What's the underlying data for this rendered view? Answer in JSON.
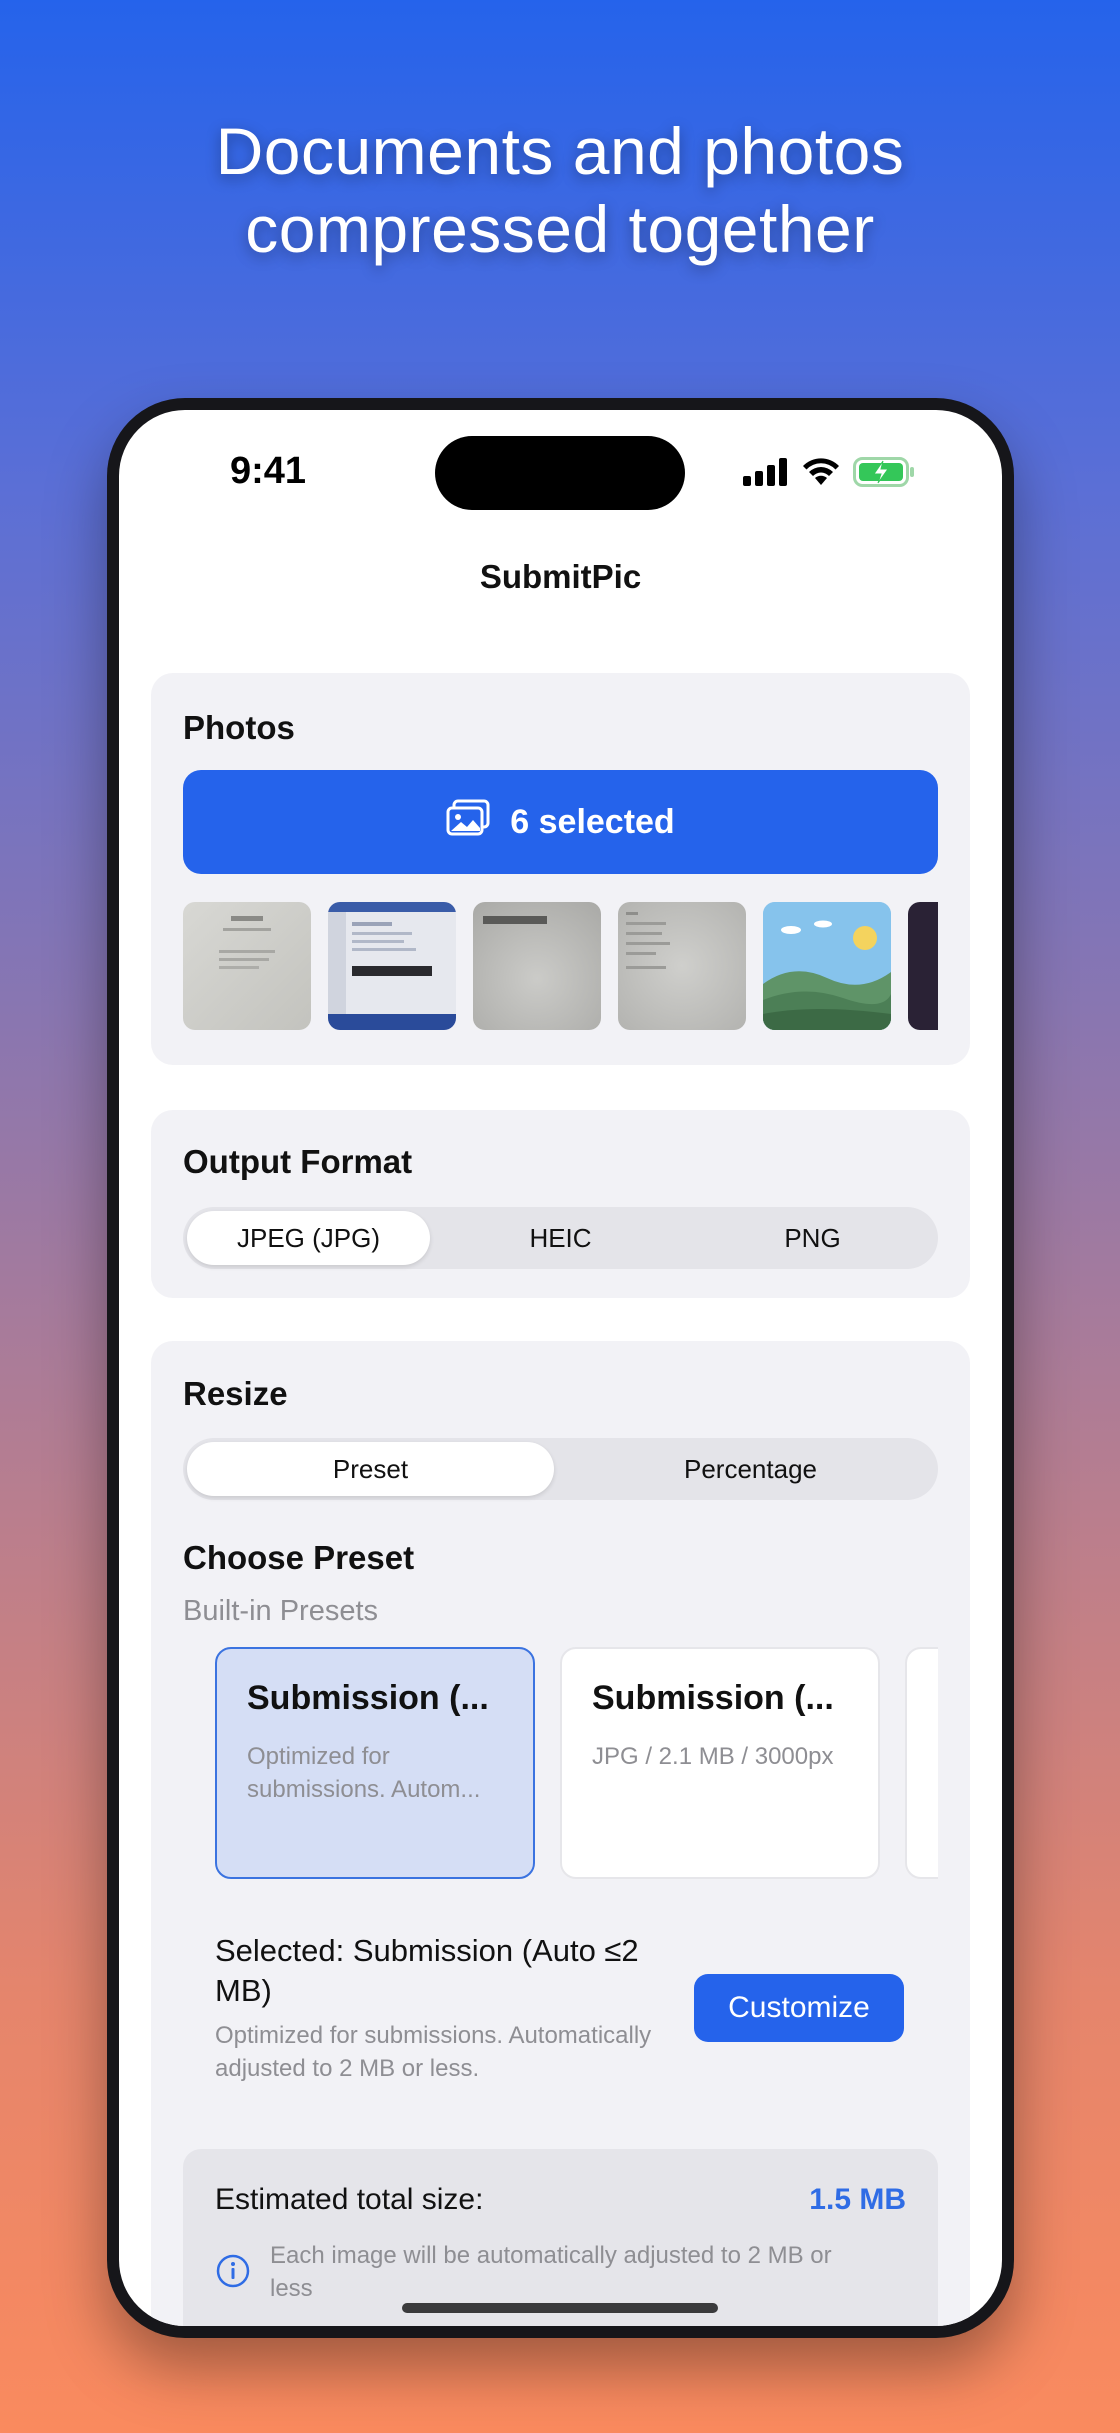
{
  "headline": {
    "line1": "Documents and photos",
    "line2": "compressed together"
  },
  "status_bar": {
    "time": "9:41",
    "icons": [
      "cellular-signal-icon",
      "wifi-icon",
      "battery-charging-icon"
    ]
  },
  "nav": {
    "title": "SubmitPic"
  },
  "photos": {
    "title": "Photos",
    "button_label": "6 selected",
    "button_icon": "photo-library-icon",
    "thumbnails": [
      "document-scan-1",
      "document-screenshot",
      "document-scan-2",
      "document-scan-3",
      "landscape-photo",
      "dark-photo"
    ]
  },
  "output_format": {
    "title": "Output Format",
    "options": [
      "JPEG (JPG)",
      "HEIC",
      "PNG"
    ],
    "selected": "JPEG (JPG)"
  },
  "resize": {
    "title": "Resize",
    "modes": [
      "Preset",
      "Percentage"
    ],
    "selected_mode": "Preset",
    "choose_preset_title": "Choose Preset",
    "builtin_label": "Built-in Presets",
    "presets": [
      {
        "title": "Submission (...",
        "desc": "Optimized for submissions. Autom...",
        "selected": true
      },
      {
        "title": "Submission (...",
        "desc": "JPG / 2.1 MB / 3000px",
        "selected": false
      }
    ],
    "selected_title": "Selected: Submission (Auto ≤2 MB)",
    "selected_desc": "Optimized for submissions. Automatically adjusted to 2 MB or less.",
    "customize_label": "Customize"
  },
  "estimate": {
    "label": "Estimated total size:",
    "value": "1.5 MB",
    "note": "Each image will be automatically adjusted to 2 MB or less"
  },
  "colors": {
    "accent": "#2563eb",
    "card_bg": "#f2f2f6",
    "selected_preset_bg": "#d5def5",
    "estimate_value": "#2f6ce5"
  }
}
